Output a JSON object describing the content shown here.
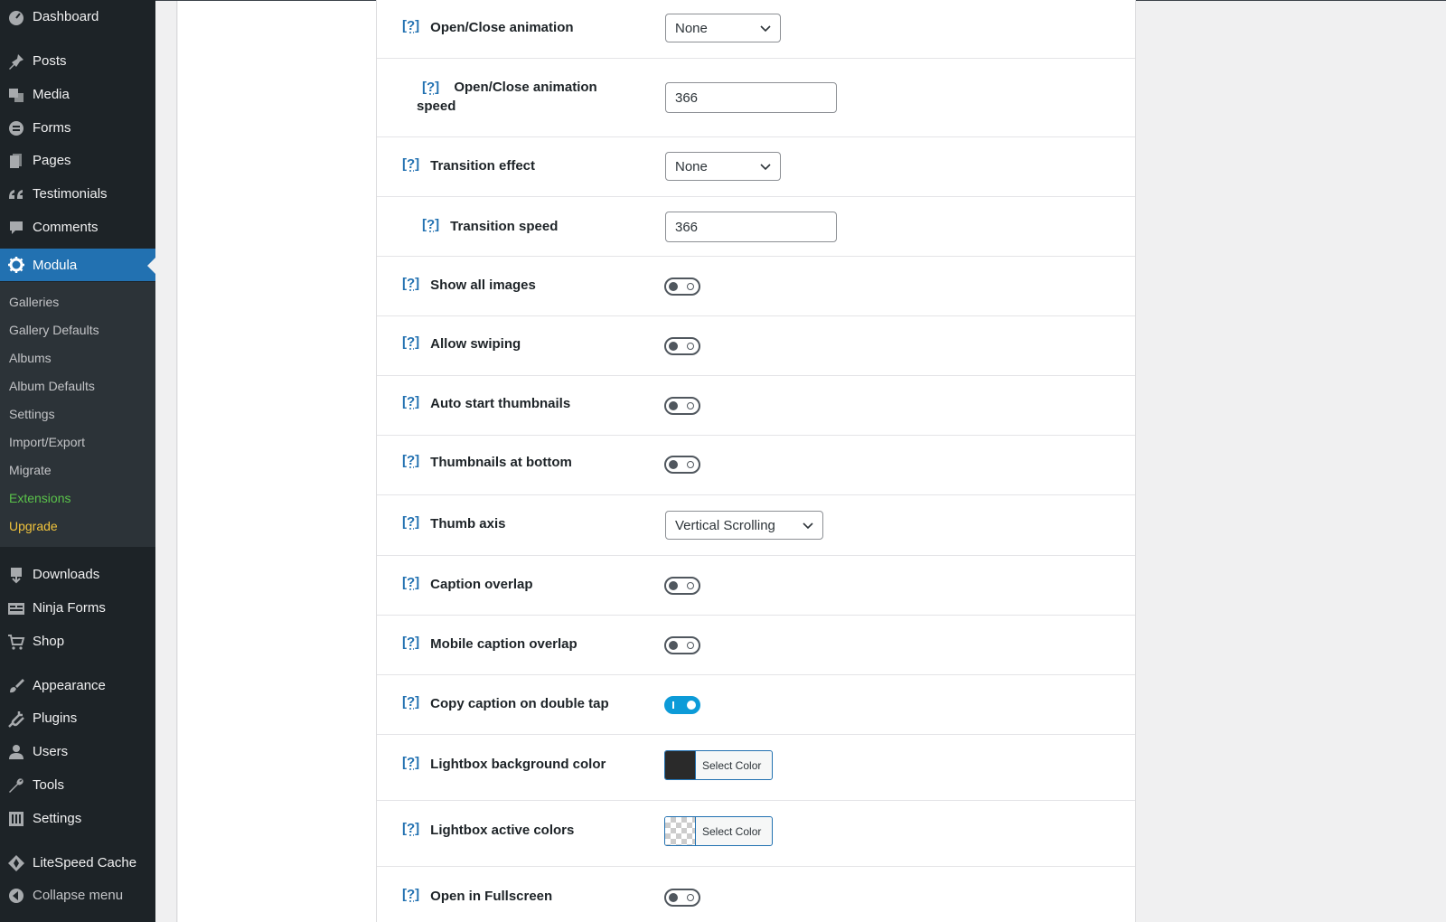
{
  "sidebar": {
    "menu": [
      {
        "label": "Dashboard",
        "icon": "dashboard-icon"
      },
      {
        "label": "Posts",
        "icon": "pin-icon"
      },
      {
        "label": "Media",
        "icon": "media-icon"
      },
      {
        "label": "Forms",
        "icon": "forms-icon"
      },
      {
        "label": "Pages",
        "icon": "pages-icon"
      },
      {
        "label": "Testimonials",
        "icon": "quote-icon"
      },
      {
        "label": "Comments",
        "icon": "comment-icon"
      },
      {
        "label": "Modula",
        "icon": "gear-icon"
      },
      {
        "label": "Downloads",
        "icon": "download-icon"
      },
      {
        "label": "Ninja Forms",
        "icon": "ninja-forms-icon"
      },
      {
        "label": "Shop",
        "icon": "cart-icon"
      },
      {
        "label": "Appearance",
        "icon": "brush-icon"
      },
      {
        "label": "Plugins",
        "icon": "plugin-icon"
      },
      {
        "label": "Users",
        "icon": "user-icon"
      },
      {
        "label": "Tools",
        "icon": "wrench-icon"
      },
      {
        "label": "Settings",
        "icon": "settings-icon"
      },
      {
        "label": "LiteSpeed Cache",
        "icon": "litespeed-icon"
      },
      {
        "label": "Collapse menu",
        "icon": "collapse-icon"
      }
    ],
    "submenu": [
      "Galleries",
      "Gallery Defaults",
      "Albums",
      "Album Defaults",
      "Settings",
      "Import/Export",
      "Migrate",
      "Extensions",
      "Upgrade"
    ]
  },
  "settings": {
    "help": "[?]",
    "open_close_animation": {
      "label": "Open/Close animation",
      "value": "None"
    },
    "open_close_speed": {
      "label": "Open/Close animation speed",
      "value": "366"
    },
    "transition_effect": {
      "label": "Transition effect",
      "value": "None"
    },
    "transition_speed": {
      "label": "Transition speed",
      "value": "366"
    },
    "show_all_images": {
      "label": "Show all images",
      "on": false
    },
    "allow_swiping": {
      "label": "Allow swiping",
      "on": false
    },
    "auto_start_thumbnails": {
      "label": "Auto start thumbnails",
      "on": false
    },
    "thumbnails_at_bottom": {
      "label": "Thumbnails at bottom",
      "on": false
    },
    "thumb_axis": {
      "label": "Thumb axis",
      "value": "Vertical Scrolling"
    },
    "caption_overlap": {
      "label": "Caption overlap",
      "on": false
    },
    "mobile_caption_overlap": {
      "label": "Mobile caption overlap",
      "on": false
    },
    "copy_caption": {
      "label": "Copy caption on double tap",
      "on": true
    },
    "lightbox_bg_color": {
      "label": "Lightbox background color",
      "button": "Select Color"
    },
    "lightbox_active_colors": {
      "label": "Lightbox active colors",
      "button": "Select Color"
    },
    "open_fullscreen": {
      "label": "Open in Fullscreen",
      "on": false
    }
  },
  "colors": {
    "accent": "#2271b1",
    "toggle_on": "#0d9bd8",
    "sidebar_bg": "#1d2327",
    "extensions": "#5ac24a",
    "upgrade": "#f0c33c"
  }
}
